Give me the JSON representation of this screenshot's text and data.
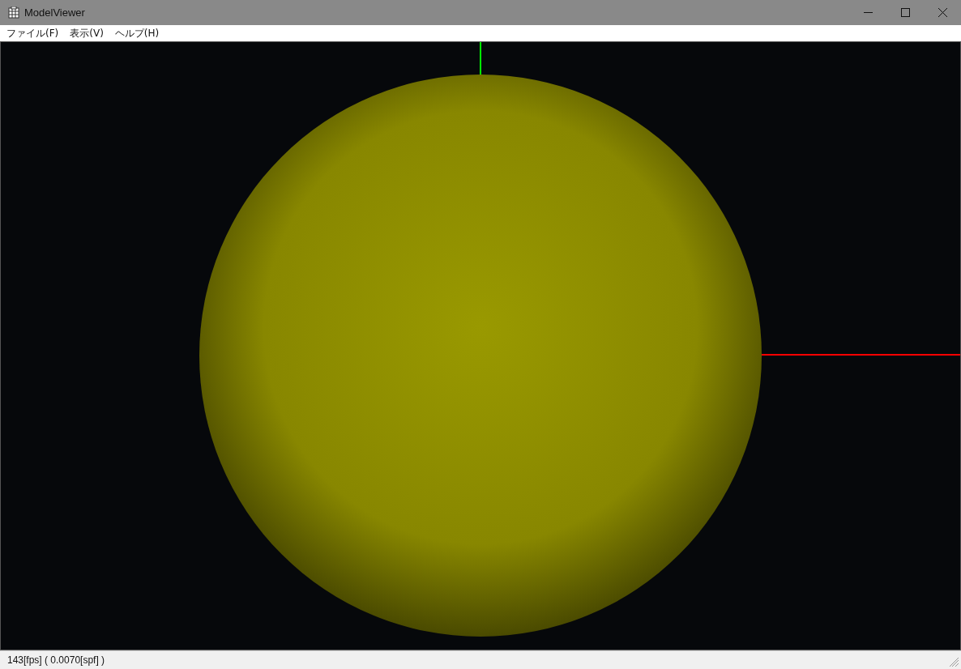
{
  "window": {
    "title": "ModelViewer"
  },
  "menu": [
    {
      "label": "ファイル(F)"
    },
    {
      "label": "表示(V)"
    },
    {
      "label": "ヘルプ(H)"
    }
  ],
  "status_bar": {
    "text": "143[fps] ( 0.0070[spf] )"
  }
}
